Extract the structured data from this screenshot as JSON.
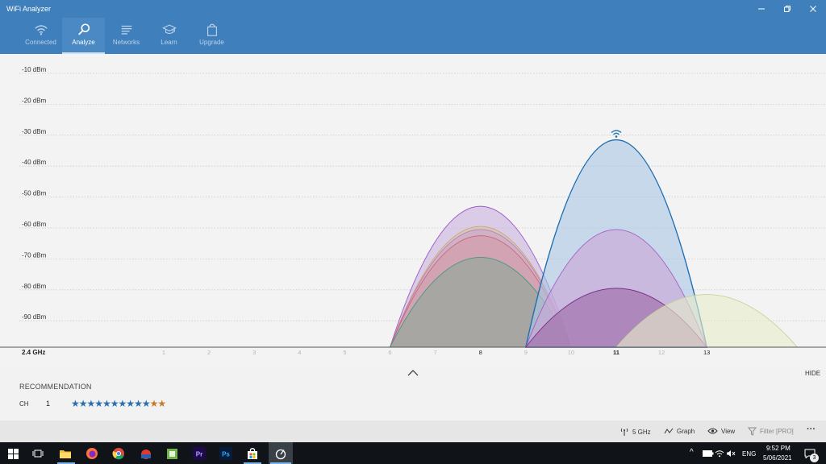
{
  "window": {
    "title": "WiFi Analyzer"
  },
  "nav": [
    {
      "label": "Connected",
      "icon": "wifi-icon",
      "active": false
    },
    {
      "label": "Analyze",
      "icon": "analyze-icon",
      "active": true
    },
    {
      "label": "Networks",
      "icon": "networks-list-icon",
      "active": false
    },
    {
      "label": "Learn",
      "icon": "graduation-cap-icon",
      "active": false
    },
    {
      "label": "Upgrade",
      "icon": "shopping-bag-icon",
      "active": false
    }
  ],
  "chart_data": {
    "type": "area",
    "band": "2.4 GHz",
    "y_ticks": [
      "-10 dBm",
      "-20 dBm",
      "-30 dBm",
      "-40 dBm",
      "-50 dBm",
      "-60 dBm",
      "-70 dBm",
      "-80 dBm",
      "-90 dBm"
    ],
    "y_values": [
      -10,
      -20,
      -30,
      -40,
      -50,
      -60,
      -70,
      -80,
      -90
    ],
    "ylim": [
      -100,
      -5
    ],
    "x_ticks": [
      "1",
      "2",
      "3",
      "4",
      "5",
      "6",
      "7",
      "8",
      "9",
      "10",
      "11",
      "12",
      "13"
    ],
    "highlighted_channels": [
      8,
      11,
      13
    ],
    "connected_channel": 11,
    "grid": true,
    "series": [
      {
        "channel": 8,
        "peak_dbm": -53,
        "fill": "#c9b3df",
        "stroke": "#9b59c9"
      },
      {
        "channel": 8,
        "peak_dbm": -59.5,
        "fill": "#d8c2a6",
        "stroke": "#c8a675"
      },
      {
        "channel": 8,
        "peak_dbm": -60.5,
        "fill": "#c8a6c8",
        "stroke": "#b97fb0"
      },
      {
        "channel": 8,
        "peak_dbm": -62.5,
        "fill": "#d39aa6",
        "stroke": "#d0607a"
      },
      {
        "channel": 8,
        "peak_dbm": -69.5,
        "fill": "#8ea89a",
        "stroke": "#3f9a7f"
      },
      {
        "channel": 11,
        "peak_dbm": -31.5,
        "fill": "#a9c7e3",
        "stroke": "#1f6fb0"
      },
      {
        "channel": 11,
        "peak_dbm": -60.5,
        "fill": "#cba7d8",
        "stroke": "#a35fc4"
      },
      {
        "channel": 11,
        "peak_dbm": -79.5,
        "fill": "#9e6aa6",
        "stroke": "#7a2f8a"
      },
      {
        "channel": 13,
        "peak_dbm": -81.5,
        "fill": "#e6ecc9",
        "stroke": "#c6d49a"
      }
    ]
  },
  "recommendation": {
    "title": "RECOMMENDATION",
    "ch_label": "CH",
    "channel": "1",
    "stars_blue": "★★★★★★★★★★",
    "stars_orange": "★★",
    "rating_blue": 10,
    "rating_orange": 2
  },
  "hide_label": "HIDE",
  "commands": {
    "band": "5 GHz",
    "graph": "Graph",
    "view": "View",
    "filter": "Filter [PRO]",
    "more": "···"
  },
  "taskbar": {
    "time": "9:52 PM",
    "date": "5/06/2021",
    "lang": "ENG",
    "notifications": "3",
    "tray_up": "^"
  },
  "colors": {
    "header": "#3f7fbb",
    "accent": "#1f6fb0"
  }
}
